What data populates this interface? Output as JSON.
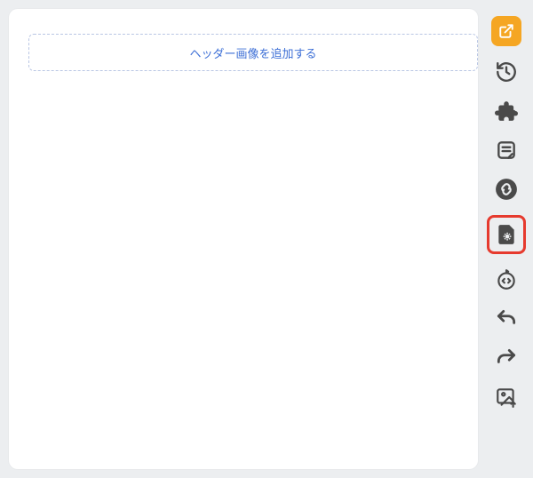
{
  "canvas": {
    "add_header_label": "ヘッダー画像を追加する"
  },
  "toolbar": {
    "publish": {
      "name": "publish-button"
    },
    "history": {
      "name": "history-button"
    },
    "plugins": {
      "name": "plugins-button"
    },
    "template": {
      "name": "template-button"
    },
    "link": {
      "name": "link-button"
    },
    "settings": {
      "name": "page-settings-button"
    },
    "code": {
      "name": "code-button"
    },
    "undo": {
      "name": "undo-button"
    },
    "redo": {
      "name": "redo-button"
    },
    "image": {
      "name": "image-upload-button"
    }
  }
}
